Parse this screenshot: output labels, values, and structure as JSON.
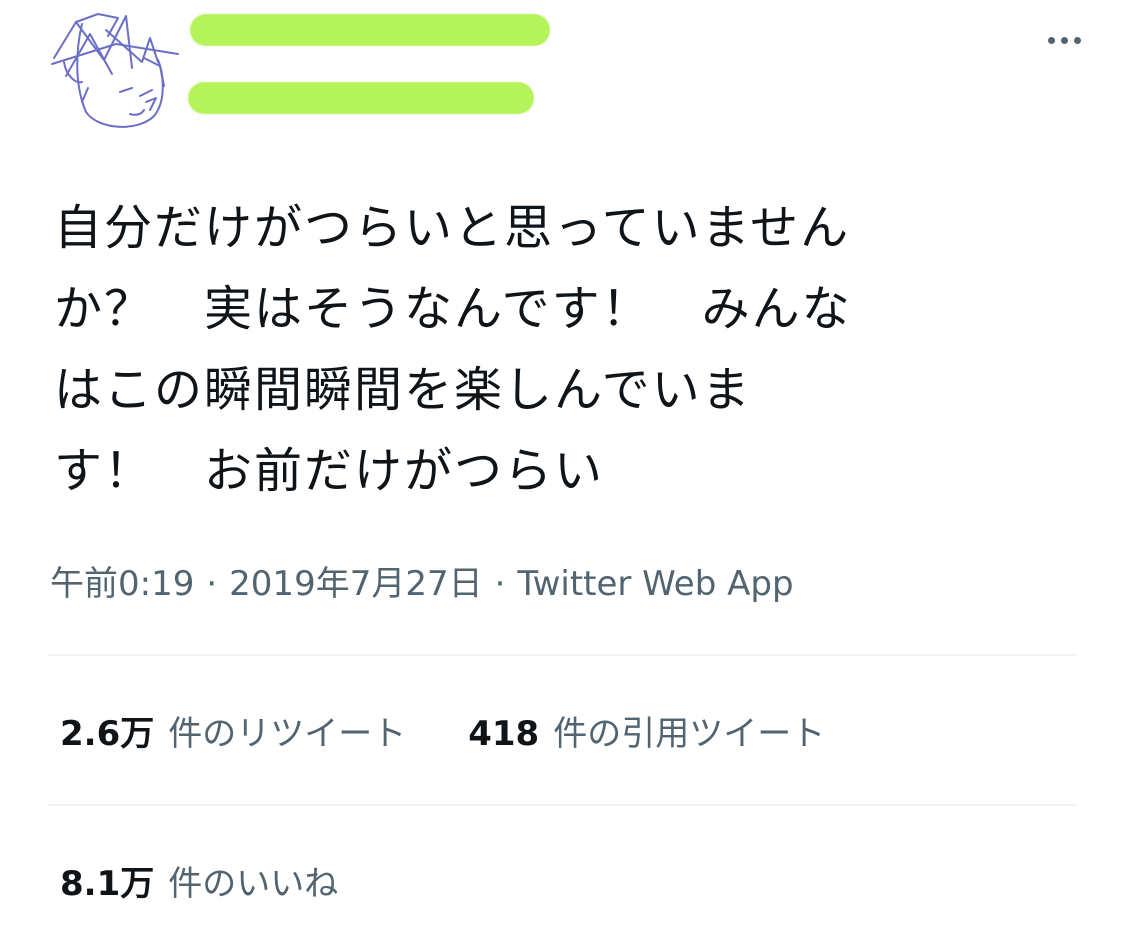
{
  "tweet": {
    "text_lines": [
      "自分だけがつらいと思っていません",
      "か？　実はそうなんです！　みんな",
      "はこの瞬間瞬間を楽しんでいま",
      "す！　お前だけがつらい"
    ],
    "time": "午前0:19",
    "separator": "·",
    "date": "2019年7月27日",
    "source": "Twitter Web App"
  },
  "stats": {
    "retweets": {
      "count": "2.6万",
      "label": "件のリツイート"
    },
    "quotes": {
      "count": "418",
      "label": "件の引用ツイート"
    },
    "likes": {
      "count": "8.1万",
      "label": "件のいいね"
    }
  },
  "icons": {
    "more": "more-horizontal-icon"
  },
  "colors": {
    "redaction": "#b5f35a",
    "secondary_text": "#536471",
    "divider": "#eff3f4",
    "avatar_ink": "#6b6fc7"
  }
}
